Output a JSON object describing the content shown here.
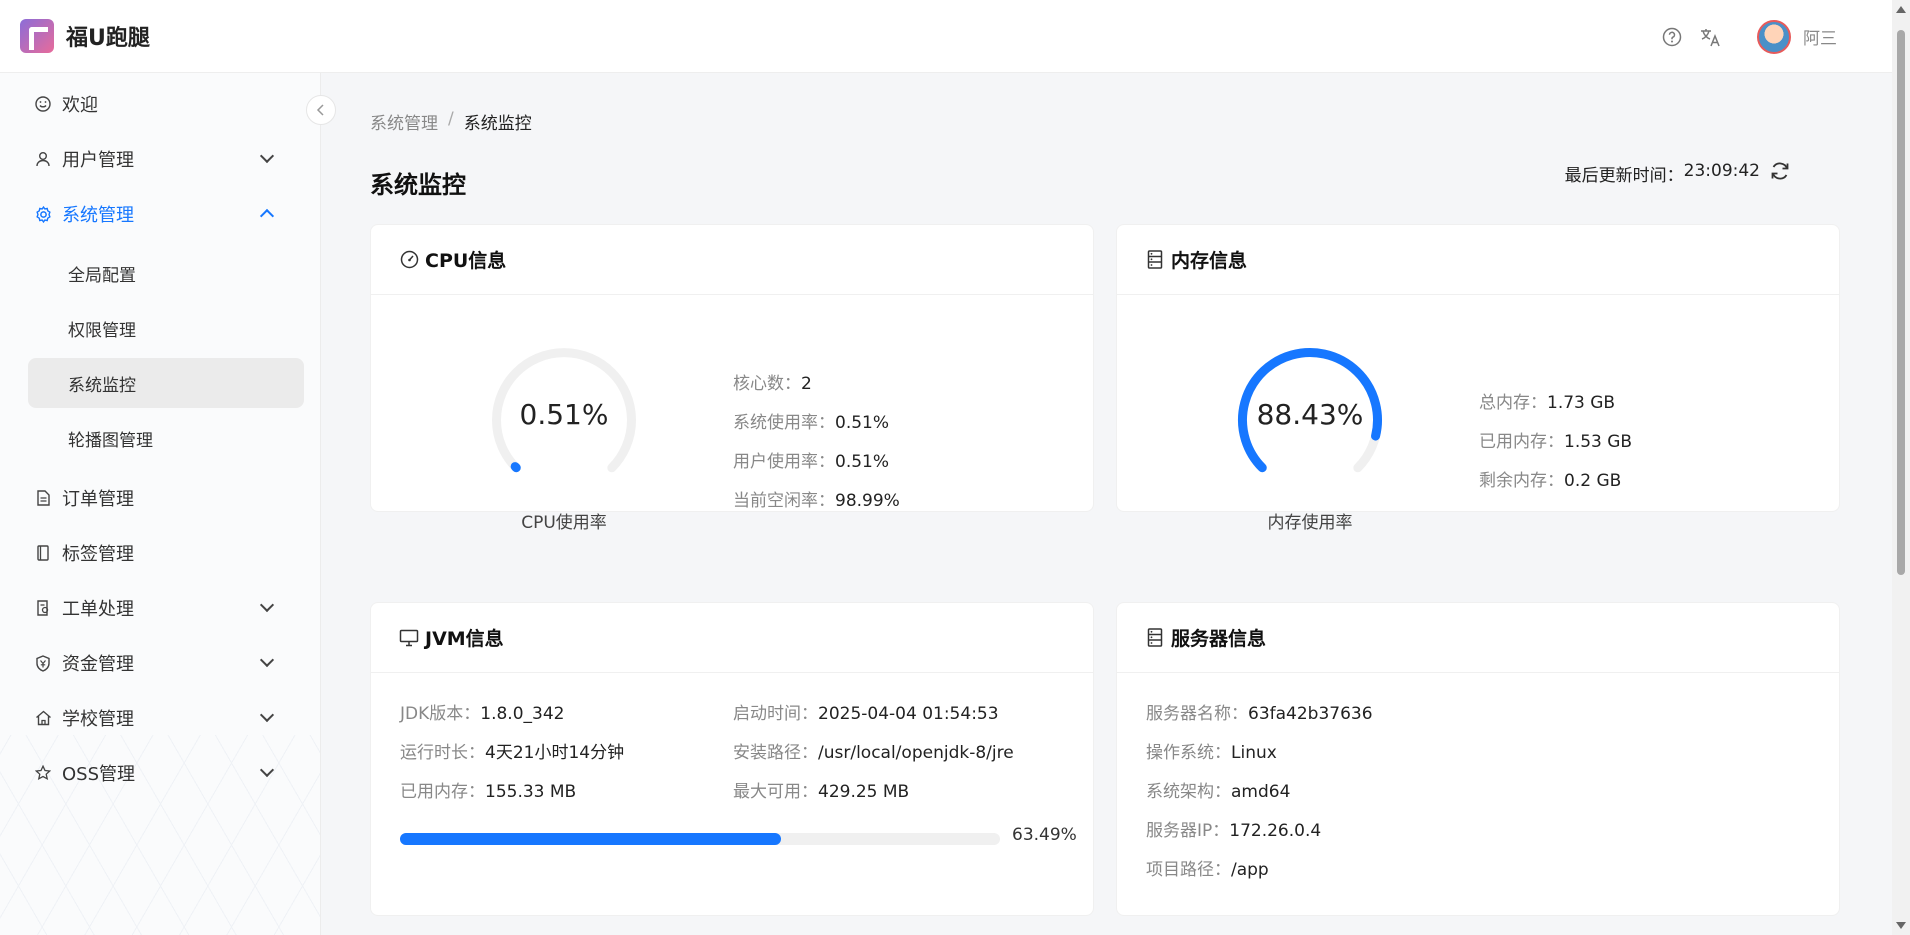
{
  "app": {
    "name": "福U跑腿"
  },
  "header": {
    "username": "阿三"
  },
  "sidebar": {
    "items": [
      {
        "label": "欢迎"
      },
      {
        "label": "用户管理"
      },
      {
        "label": "系统管理"
      },
      {
        "label": "订单管理"
      },
      {
        "label": "标签管理"
      },
      {
        "label": "工单处理"
      },
      {
        "label": "资金管理"
      },
      {
        "label": "学校管理"
      },
      {
        "label": "OSS管理"
      }
    ],
    "sub_items": [
      {
        "label": "全局配置"
      },
      {
        "label": "权限管理"
      },
      {
        "label": "系统监控"
      },
      {
        "label": "轮播图管理"
      }
    ]
  },
  "breadcrumb": {
    "parent": "系统管理",
    "separator": "/",
    "current": "系统监控"
  },
  "page": {
    "title": "系统监控",
    "updated_label": "最后更新时间：",
    "updated_time": "23:09:42"
  },
  "cpu": {
    "title": "CPU信息",
    "gauge_value": "0.51%",
    "gauge_percent": 0.51,
    "gauge_label": "CPU使用率",
    "stats": [
      {
        "key": "核心数：",
        "value": "2"
      },
      {
        "key": "系统使用率：",
        "value": "0.51%"
      },
      {
        "key": "用户使用率：",
        "value": "0.51%"
      },
      {
        "key": "当前空闲率：",
        "value": "98.99%"
      }
    ]
  },
  "memory": {
    "title": "内存信息",
    "gauge_value": "88.43%",
    "gauge_percent": 88.43,
    "gauge_label": "内存使用率",
    "stats": [
      {
        "key": "总内存：",
        "value": "1.73 GB"
      },
      {
        "key": "已用内存：",
        "value": "1.53 GB"
      },
      {
        "key": "剩余内存：",
        "value": "0.2 GB"
      }
    ]
  },
  "jvm": {
    "title": "JVM信息",
    "left": [
      {
        "key": "JDK版本：",
        "value": "1.8.0_342"
      },
      {
        "key": "运行时长：",
        "value": "4天21小时14分钟"
      },
      {
        "key": "已用内存：",
        "value": "155.33 MB"
      }
    ],
    "right": [
      {
        "key": "启动时间：",
        "value": "2025-04-04 01:54:53"
      },
      {
        "key": "安装路径：",
        "value": "/usr/local/openjdk-8/jre"
      },
      {
        "key": "最大可用：",
        "value": "429.25 MB"
      }
    ],
    "usage_percent": 63.49,
    "usage_text": "63.49%"
  },
  "server": {
    "title": "服务器信息",
    "stats": [
      {
        "key": "服务器名称：",
        "value": "63fa42b37636"
      },
      {
        "key": "操作系统：",
        "value": "Linux"
      },
      {
        "key": "系统架构：",
        "value": "amd64"
      },
      {
        "key": "服务器IP：",
        "value": "172.26.0.4"
      },
      {
        "key": "项目路径：",
        "value": "/app"
      }
    ]
  },
  "colors": {
    "accent": "#1677ff",
    "track": "#f0f0f0"
  }
}
